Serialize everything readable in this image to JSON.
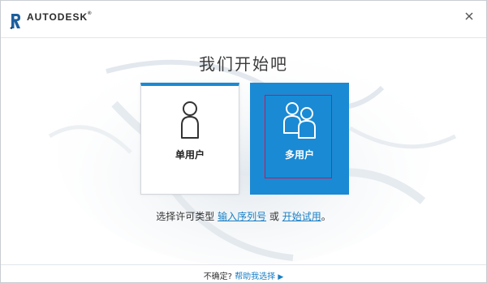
{
  "header": {
    "brand": "AUTODESK",
    "brand_mark": "®",
    "logo_icon": "revit-r-logo",
    "close_icon": "close-icon"
  },
  "main": {
    "heading": "我们开始吧",
    "cards": [
      {
        "label": "单用户",
        "icon": "single-user-icon"
      },
      {
        "label": "多用户",
        "icon": "multi-user-icon"
      }
    ],
    "choose_prefix": "选择许可类型",
    "choose_link1": "输入序列号",
    "choose_or": "或",
    "choose_link2": "开始试用",
    "choose_suffix": "。"
  },
  "footer": {
    "question": "不确定?",
    "help_link": "帮助我选择",
    "arrow_icon": "play-arrow-icon"
  },
  "colors": {
    "accent": "#1a8ad4",
    "link": "#1a7fc4",
    "focus": "#c2185b"
  }
}
